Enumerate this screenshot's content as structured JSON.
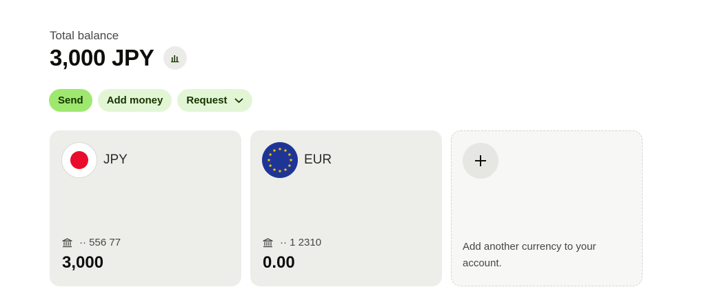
{
  "header": {
    "label": "Total balance",
    "amount": "3,000 JPY",
    "insights_icon": "bar-chart-icon"
  },
  "actions": {
    "send": "Send",
    "add_money": "Add money",
    "request": "Request"
  },
  "accounts": [
    {
      "code": "JPY",
      "flag": "japan-flag-icon",
      "account_number": "·· 556 77",
      "balance": "3,000"
    },
    {
      "code": "EUR",
      "flag": "eu-flag-icon",
      "account_number": "·· 1 2310",
      "balance": "0.00"
    }
  ],
  "add_currency": {
    "icon": "plus-icon",
    "text": "Add another currency to your account."
  },
  "colors": {
    "primary_green": "#9fe870",
    "secondary_green": "#e2f6d5",
    "dark_green_text": "#163300",
    "card_bg": "#edeeea"
  }
}
